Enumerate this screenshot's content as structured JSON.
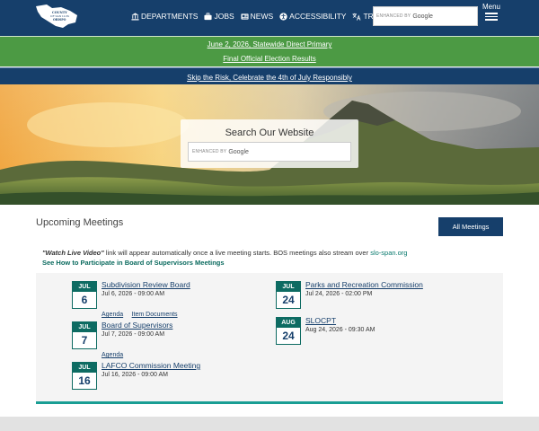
{
  "header": {
    "logo_text": "COUNTY OF SAN LUIS OBISPO",
    "nav": [
      {
        "label": "DEPARTMENTS",
        "icon": "building-icon"
      },
      {
        "label": "JOBS",
        "icon": "briefcase-icon"
      },
      {
        "label": "NEWS",
        "icon": "newspaper-icon"
      },
      {
        "label": "ACCESSIBILITY",
        "icon": "accessibility-icon"
      },
      {
        "label": "TRANSLATE",
        "icon": "translate-icon"
      }
    ],
    "search_enhanced": "ENHANCED BY",
    "search_google": "Google",
    "menu_label": "Menu"
  },
  "alerts": {
    "primary_line1": "June 2, 2026, Statewide Direct Primary",
    "primary_line2": "Final Official Election Results",
    "safety": "Skip the Risk, Celebrate the 4th of July Responsibly"
  },
  "hero": {
    "search_title": "Search Our Website",
    "search_enhanced": "ENHANCED BY",
    "search_google": "Google"
  },
  "meetings": {
    "title": "Upcoming Meetings",
    "all_button": "All Meetings",
    "note_bold": "\"Watch Live Video\"",
    "note_text": " link will appear automatically once a live meeting starts. BOS meetings also stream over ",
    "note_link": "slo-span.org",
    "participate_link": "See How to Participate in Board of Supervisors Meetings",
    "items": [
      {
        "month": "JUL",
        "day": "6",
        "title": "Subdivision Review Board",
        "date": "Jul  6, 2026 - 09:00 AM",
        "links": [
          "Agenda",
          "Item Documents"
        ]
      },
      {
        "month": "JUL",
        "day": "7",
        "title": "Board of Supervisors",
        "date": "Jul  7, 2026 - 09:00 AM",
        "links": [
          "Agenda"
        ]
      },
      {
        "month": "JUL",
        "day": "16",
        "title": "LAFCO Commission Meeting",
        "date": "Jul 16, 2026 - 09:00 AM",
        "links": []
      },
      {
        "month": "JUL",
        "day": "24",
        "title": "Parks and Recreation Commission",
        "date": "Jul 24, 2026 - 02:00 PM",
        "links": []
      },
      {
        "month": "AUG",
        "day": "24",
        "title": "SLOCPT",
        "date": "Aug 24, 2026 - 09:30 AM",
        "links": []
      }
    ]
  },
  "colors": {
    "navy": "#163f6b",
    "alert_green": "#4c9a44",
    "teal": "#0d6b62",
    "accent_line": "#1a9e94"
  }
}
